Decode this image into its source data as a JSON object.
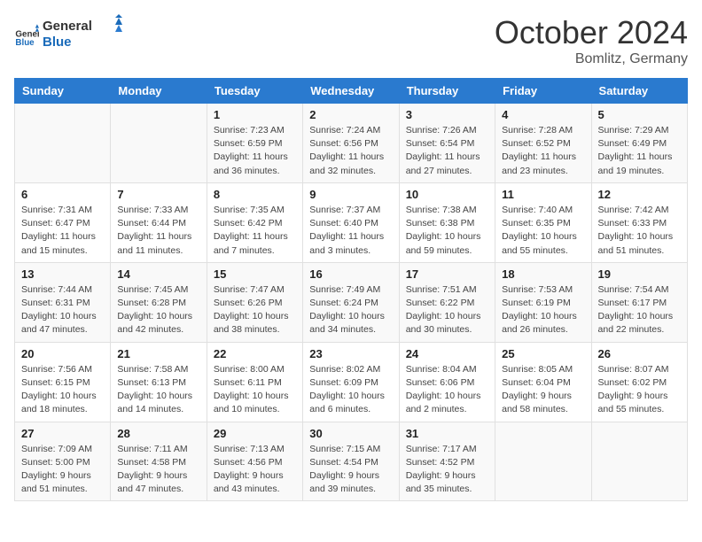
{
  "logo": {
    "general": "General",
    "blue": "Blue"
  },
  "header": {
    "month": "October 2024",
    "location": "Bomlitz, Germany"
  },
  "weekdays": [
    "Sunday",
    "Monday",
    "Tuesday",
    "Wednesday",
    "Thursday",
    "Friday",
    "Saturday"
  ],
  "weeks": [
    [
      null,
      null,
      {
        "day": 1,
        "sunrise": "7:23 AM",
        "sunset": "6:59 PM",
        "daylight": "11 hours and 36 minutes."
      },
      {
        "day": 2,
        "sunrise": "7:24 AM",
        "sunset": "6:56 PM",
        "daylight": "11 hours and 32 minutes."
      },
      {
        "day": 3,
        "sunrise": "7:26 AM",
        "sunset": "6:54 PM",
        "daylight": "11 hours and 27 minutes."
      },
      {
        "day": 4,
        "sunrise": "7:28 AM",
        "sunset": "6:52 PM",
        "daylight": "11 hours and 23 minutes."
      },
      {
        "day": 5,
        "sunrise": "7:29 AM",
        "sunset": "6:49 PM",
        "daylight": "11 hours and 19 minutes."
      }
    ],
    [
      {
        "day": 6,
        "sunrise": "7:31 AM",
        "sunset": "6:47 PM",
        "daylight": "11 hours and 15 minutes."
      },
      {
        "day": 7,
        "sunrise": "7:33 AM",
        "sunset": "6:44 PM",
        "daylight": "11 hours and 11 minutes."
      },
      {
        "day": 8,
        "sunrise": "7:35 AM",
        "sunset": "6:42 PM",
        "daylight": "11 hours and 7 minutes."
      },
      {
        "day": 9,
        "sunrise": "7:37 AM",
        "sunset": "6:40 PM",
        "daylight": "11 hours and 3 minutes."
      },
      {
        "day": 10,
        "sunrise": "7:38 AM",
        "sunset": "6:38 PM",
        "daylight": "10 hours and 59 minutes."
      },
      {
        "day": 11,
        "sunrise": "7:40 AM",
        "sunset": "6:35 PM",
        "daylight": "10 hours and 55 minutes."
      },
      {
        "day": 12,
        "sunrise": "7:42 AM",
        "sunset": "6:33 PM",
        "daylight": "10 hours and 51 minutes."
      }
    ],
    [
      {
        "day": 13,
        "sunrise": "7:44 AM",
        "sunset": "6:31 PM",
        "daylight": "10 hours and 47 minutes."
      },
      {
        "day": 14,
        "sunrise": "7:45 AM",
        "sunset": "6:28 PM",
        "daylight": "10 hours and 42 minutes."
      },
      {
        "day": 15,
        "sunrise": "7:47 AM",
        "sunset": "6:26 PM",
        "daylight": "10 hours and 38 minutes."
      },
      {
        "day": 16,
        "sunrise": "7:49 AM",
        "sunset": "6:24 PM",
        "daylight": "10 hours and 34 minutes."
      },
      {
        "day": 17,
        "sunrise": "7:51 AM",
        "sunset": "6:22 PM",
        "daylight": "10 hours and 30 minutes."
      },
      {
        "day": 18,
        "sunrise": "7:53 AM",
        "sunset": "6:19 PM",
        "daylight": "10 hours and 26 minutes."
      },
      {
        "day": 19,
        "sunrise": "7:54 AM",
        "sunset": "6:17 PM",
        "daylight": "10 hours and 22 minutes."
      }
    ],
    [
      {
        "day": 20,
        "sunrise": "7:56 AM",
        "sunset": "6:15 PM",
        "daylight": "10 hours and 18 minutes."
      },
      {
        "day": 21,
        "sunrise": "7:58 AM",
        "sunset": "6:13 PM",
        "daylight": "10 hours and 14 minutes."
      },
      {
        "day": 22,
        "sunrise": "8:00 AM",
        "sunset": "6:11 PM",
        "daylight": "10 hours and 10 minutes."
      },
      {
        "day": 23,
        "sunrise": "8:02 AM",
        "sunset": "6:09 PM",
        "daylight": "10 hours and 6 minutes."
      },
      {
        "day": 24,
        "sunrise": "8:04 AM",
        "sunset": "6:06 PM",
        "daylight": "10 hours and 2 minutes."
      },
      {
        "day": 25,
        "sunrise": "8:05 AM",
        "sunset": "6:04 PM",
        "daylight": "9 hours and 58 minutes."
      },
      {
        "day": 26,
        "sunrise": "8:07 AM",
        "sunset": "6:02 PM",
        "daylight": "9 hours and 55 minutes."
      }
    ],
    [
      {
        "day": 27,
        "sunrise": "7:09 AM",
        "sunset": "5:00 PM",
        "daylight": "9 hours and 51 minutes."
      },
      {
        "day": 28,
        "sunrise": "7:11 AM",
        "sunset": "4:58 PM",
        "daylight": "9 hours and 47 minutes."
      },
      {
        "day": 29,
        "sunrise": "7:13 AM",
        "sunset": "4:56 PM",
        "daylight": "9 hours and 43 minutes."
      },
      {
        "day": 30,
        "sunrise": "7:15 AM",
        "sunset": "4:54 PM",
        "daylight": "9 hours and 39 minutes."
      },
      {
        "day": 31,
        "sunrise": "7:17 AM",
        "sunset": "4:52 PM",
        "daylight": "9 hours and 35 minutes."
      },
      null,
      null
    ]
  ],
  "labels": {
    "sunrise": "Sunrise:",
    "sunset": "Sunset:",
    "daylight": "Daylight:"
  }
}
